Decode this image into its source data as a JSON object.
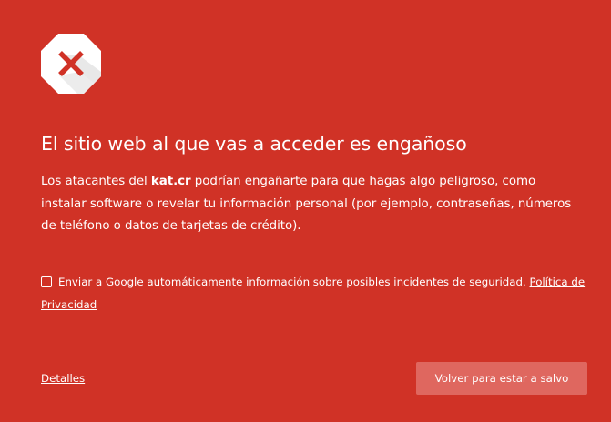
{
  "warning": {
    "icon": "stop-octagon-x-icon",
    "title": "El sitio web al que vas a acceder es engañoso",
    "description_prefix": "Los atacantes del ",
    "site": "kat.cr",
    "description_suffix": " podrían engañarte para que hagas algo peligroso, como instalar software o revelar tu información personal (por ejemplo, contraseñas, números de teléfono o datos de tarjetas de crédito)."
  },
  "report": {
    "checked": false,
    "label": "Enviar a Google automáticamente información sobre posibles incidentes de seguridad.",
    "privacy_link": "Política de Privacidad"
  },
  "actions": {
    "details_label": "Detalles",
    "back_label": "Volver para estar a salvo"
  },
  "colors": {
    "background": "#d03226",
    "button": "#df675f",
    "icon_x": "#d03226"
  }
}
